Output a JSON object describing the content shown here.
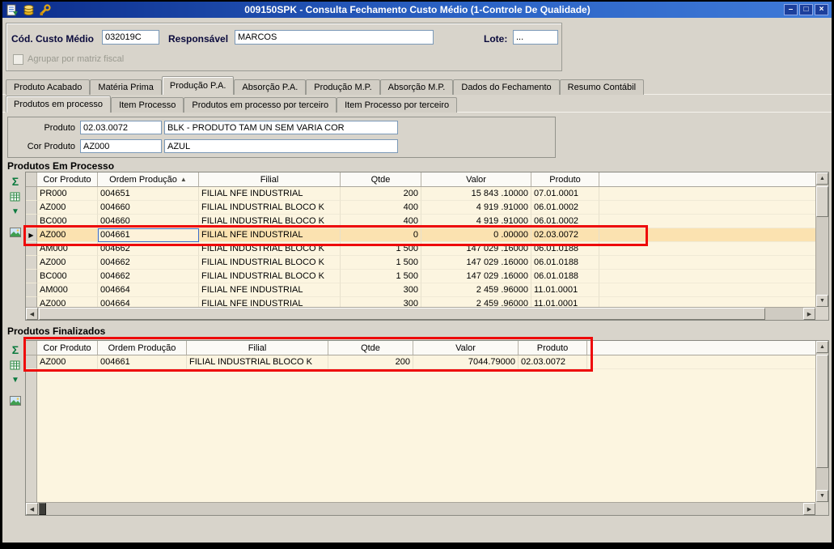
{
  "window": {
    "title": "009150SPK - Consulta Fechamento Custo Médio (1-Controle De Qualidade)",
    "controls": {
      "minimize": "–",
      "maximize": "□",
      "close": "×"
    }
  },
  "icons": {
    "sort_asc": "▲",
    "scroll_up": "▲",
    "scroll_down": "▼",
    "scroll_left": "◀",
    "scroll_right": "▶",
    "row_pointer": "▶",
    "sum": "Σ",
    "down_arrow": "▼"
  },
  "colors": {
    "annotation_red": "#ee0a0a",
    "selected_row": "#fbe2b0",
    "grid_row": "#fcf5e0",
    "titlebar_blue": "#1c3f9c"
  },
  "header": {
    "cod_custo_medio_label": "Cód. Custo Médio",
    "cod_custo_medio_value": "032019C",
    "responsavel_label": "Responsável",
    "responsavel_value": "MARCOS",
    "lote_label": "Lote:",
    "lote_value": "...",
    "agrupar_checkbox_label": "Agrupar por matriz fiscal",
    "agrupar_checked": false
  },
  "main_tabs": [
    {
      "label": "Produto Acabado",
      "active": false
    },
    {
      "label": "Matéria Prima",
      "active": false
    },
    {
      "label": "Produção P.A.",
      "active": true
    },
    {
      "label": "Absorção P.A.",
      "active": false
    },
    {
      "label": "Produção M.P.",
      "active": false
    },
    {
      "label": "Absorção M.P.",
      "active": false
    },
    {
      "label": "Dados do Fechamento",
      "active": false
    },
    {
      "label": "Resumo Contábil",
      "active": false
    }
  ],
  "sub_tabs": [
    {
      "label": "Produtos em processo",
      "active": true
    },
    {
      "label": "Item Processo",
      "active": false
    },
    {
      "label": "Produtos em processo por terceiro",
      "active": false
    },
    {
      "label": "Item Processo por terceiro",
      "active": false
    }
  ],
  "product_form": {
    "produto_label": "Produto",
    "produto_code": "02.03.0072",
    "produto_desc": "BLK - PRODUTO TAM UN SEM VARIA COR",
    "cor_produto_label": "Cor Produto",
    "cor_code": "AZ000",
    "cor_desc": "AZUL"
  },
  "produtos_em_processo": {
    "title": "Produtos Em Processo",
    "columns": [
      "Cor Produto",
      "Ordem Produção",
      "Filial",
      "Qtde",
      "Valor",
      "Produto"
    ],
    "sorted_column": "Ordem Produção",
    "sort_indicator": "▲",
    "selected_row_index": 3,
    "focused_cell": "ordem",
    "rows": [
      {
        "cor": "PR000",
        "ordem": "004651",
        "filial": "FILIAL NFE INDUSTRIAL",
        "qtde": "200",
        "valor": "15 843 .10000",
        "produto": "07.01.0001"
      },
      {
        "cor": "AZ000",
        "ordem": "004660",
        "filial": "FILIAL INDUSTRIAL BLOCO K",
        "qtde": "400",
        "valor": "4 919 .91000",
        "produto": "06.01.0002"
      },
      {
        "cor": "BC000",
        "ordem": "004660",
        "filial": "FILIAL INDUSTRIAL BLOCO K",
        "qtde": "400",
        "valor": "4 919 .91000",
        "produto": "06.01.0002"
      },
      {
        "cor": "AZ000",
        "ordem": "004661",
        "filial": "FILIAL NFE INDUSTRIAL",
        "qtde": "0",
        "valor": "0 .00000",
        "produto": "02.03.0072"
      },
      {
        "cor": "AM000",
        "ordem": "004662",
        "filial": "FILIAL INDUSTRIAL BLOCO K",
        "qtde": "1 500",
        "valor": "147 029 .16000",
        "produto": "06.01.0188"
      },
      {
        "cor": "AZ000",
        "ordem": "004662",
        "filial": "FILIAL INDUSTRIAL BLOCO K",
        "qtde": "1 500",
        "valor": "147 029 .16000",
        "produto": "06.01.0188"
      },
      {
        "cor": "BC000",
        "ordem": "004662",
        "filial": "FILIAL INDUSTRIAL BLOCO K",
        "qtde": "1 500",
        "valor": "147 029 .16000",
        "produto": "06.01.0188"
      },
      {
        "cor": "AM000",
        "ordem": "004664",
        "filial": "FILIAL NFE INDUSTRIAL",
        "qtde": "300",
        "valor": "2 459 .96000",
        "produto": "11.01.0001"
      },
      {
        "cor": "AZ000",
        "ordem": "004664",
        "filial": "FILIAL NFE INDUSTRIAL",
        "qtde": "300",
        "valor": "2 459 .96000",
        "produto": "11.01.0001"
      }
    ]
  },
  "produtos_finalizados": {
    "title": "Produtos Finalizados",
    "columns": [
      "Cor Produto",
      "Ordem Produção",
      "Filial",
      "Qtde",
      "Valor",
      "Produto"
    ],
    "selected_row_index": null,
    "rows": [
      {
        "cor": "AZ000",
        "ordem": "004661",
        "filial": "FILIAL INDUSTRIAL BLOCO K",
        "qtde": "200",
        "valor": "7044.79000",
        "produto": "02.03.0072"
      }
    ]
  }
}
